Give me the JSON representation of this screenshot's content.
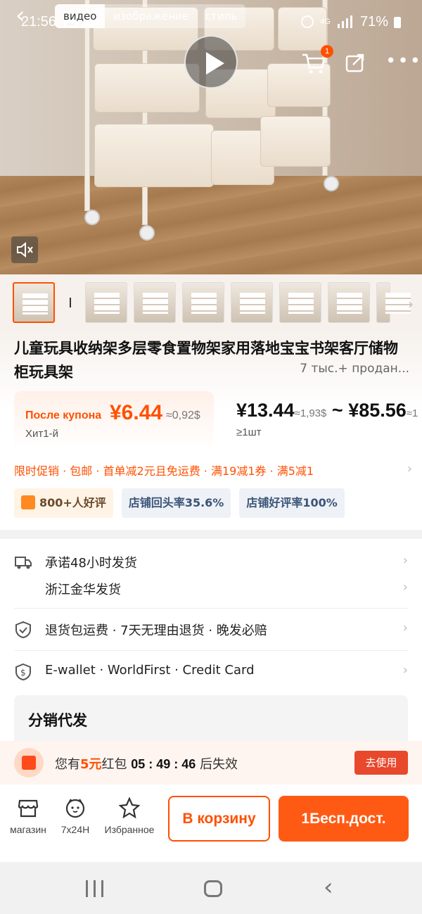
{
  "status_bar": {
    "time": "21:56",
    "network": "4G",
    "battery": "71%"
  },
  "top_nav": {
    "tabs": [
      {
        "label": "видео",
        "active": true
      },
      {
        "label": "изображение",
        "active": false
      },
      {
        "label": "стиль",
        "active": false
      }
    ],
    "cart_badge": "1"
  },
  "product": {
    "title": "儿童玩具收纳架多层零食置物架家用落地宝宝书架客厅储物柜玩具架",
    "sold": "7 тыс.+ продан...",
    "coupon_label": "После купона",
    "coupon_price": "¥6.44",
    "coupon_conversion": "≈0,92$",
    "hit": "Хит1-й",
    "price_low": "¥13.44",
    "price_low_conv": "≈1,93$",
    "price_sep": "~",
    "price_high": "¥85.56",
    "price_high_conv": "≈1",
    "moq": "≥1шт",
    "promo": "限时促销 · 包邮 · 首单减2元且免运费 · 满19减1券 · 满5减1",
    "badges": [
      {
        "label": "800+人好评",
        "style": "orange"
      },
      {
        "label": "店铺回头率35.6%",
        "style": "blue"
      },
      {
        "label": "店铺好评率100%",
        "style": "blue"
      }
    ]
  },
  "service": {
    "shipping_promise": "承诺48小时发货",
    "ship_from": "浙江金华发货",
    "returns": "退货包运费 · 7天无理由退货 · 晚发必赔",
    "payment": "E-wallet · WorldFirst · Credit Card",
    "distribution_title": "分销代发"
  },
  "red_packet": {
    "prefix": "您有",
    "amount": "5元",
    "middle": "红包",
    "countdown": "05 : 49 : 46",
    "suffix": "后失效",
    "button": "去使用"
  },
  "bottom_bar": {
    "shop": "магазин",
    "support": "7x24H",
    "favorite": "Избранное",
    "add_to_cart": "В корзину",
    "buy": "1Бесп.дост."
  },
  "colors": {
    "accent": "#ff5000",
    "buy_button": "#ff5a14",
    "red_packet_button": "#e8482c"
  },
  "icons": [
    "image-icon",
    "notification-icon",
    "alarm-icon",
    "signal-icon",
    "battery-icon",
    "back-icon",
    "play-icon",
    "cart-icon",
    "share-icon",
    "more-icon",
    "mute-icon",
    "truck-icon",
    "shield-icon",
    "wallet-icon",
    "red-packet-icon",
    "shop-icon",
    "support-icon",
    "star-icon"
  ]
}
